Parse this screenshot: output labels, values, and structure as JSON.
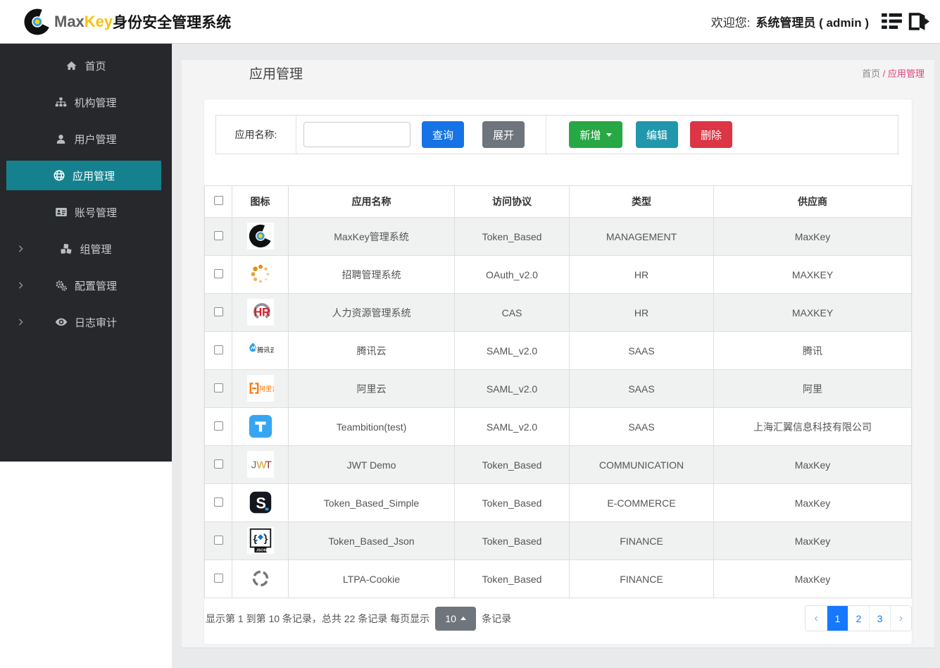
{
  "header": {
    "logo_text_max": "Max",
    "logo_text_key": "Key",
    "logo_text_cn": "身份安全管理系统",
    "welcome_label": "欢迎您:",
    "user_label": "系统管理员 ( admin )"
  },
  "sidebar": {
    "items": [
      {
        "key": "home",
        "icon": "home",
        "label": "首页",
        "active": false,
        "has_children": false
      },
      {
        "key": "org",
        "icon": "sitemap",
        "label": "机构管理",
        "active": false,
        "has_children": false
      },
      {
        "key": "users",
        "icon": "user",
        "label": "用户管理",
        "active": false,
        "has_children": false
      },
      {
        "key": "apps",
        "icon": "globe",
        "label": "应用管理",
        "active": true,
        "has_children": false
      },
      {
        "key": "accounts",
        "icon": "id-card",
        "label": "账号管理",
        "active": false,
        "has_children": false
      },
      {
        "key": "groups",
        "icon": "cubes",
        "label": "组管理",
        "active": false,
        "has_children": true
      },
      {
        "key": "config",
        "icon": "gears",
        "label": "配置管理",
        "active": false,
        "has_children": true
      },
      {
        "key": "audit",
        "icon": "eye",
        "label": "日志审计",
        "active": false,
        "has_children": true
      }
    ]
  },
  "page": {
    "title": "应用管理",
    "breadcrumb": {
      "root": "首页",
      "separator": " / ",
      "current": "应用管理"
    }
  },
  "toolbar": {
    "search_label": "应用名称:",
    "search_value": "",
    "query_label": "查询",
    "expand_label": "展开",
    "add_label": "新增",
    "edit_label": "编辑",
    "delete_label": "删除"
  },
  "table": {
    "headers": [
      "图标",
      "应用名称",
      "访问协议",
      "类型",
      "供应商"
    ],
    "rows": [
      {
        "icon": "maxkey",
        "name": "MaxKey管理系统",
        "protocol": "Token_Based",
        "type": "MANAGEMENT",
        "vendor": "MaxKey"
      },
      {
        "icon": "spinner-dots",
        "name": "招聘管理系统",
        "protocol": "OAuth_v2.0",
        "type": "HR",
        "vendor": "MAXKEY"
      },
      {
        "icon": "hr-logo",
        "name": "人力资源管理系统",
        "protocol": "CAS",
        "type": "HR",
        "vendor": "MAXKEY"
      },
      {
        "icon": "tencent-cloud",
        "name": "腾讯云",
        "protocol": "SAML_v2.0",
        "type": "SAAS",
        "vendor": "腾讯"
      },
      {
        "icon": "aliyun",
        "name": "阿里云",
        "protocol": "SAML_v2.0",
        "type": "SAAS",
        "vendor": "阿里"
      },
      {
        "icon": "teambition",
        "name": "Teambition(test)",
        "protocol": "SAML_v2.0",
        "type": "SAAS",
        "vendor": "上海汇翼信息科技有限公司"
      },
      {
        "icon": "jwt",
        "name": "JWT Demo",
        "protocol": "Token_Based",
        "type": "COMMUNICATION",
        "vendor": "MaxKey"
      },
      {
        "icon": "s-logo",
        "name": "Token_Based_Simple",
        "protocol": "Token_Based",
        "type": "E-COMMERCE",
        "vendor": "MaxKey"
      },
      {
        "icon": "json-logo",
        "name": "Token_Based_Json",
        "protocol": "Token_Based",
        "type": "FINANCE",
        "vendor": "MaxKey"
      },
      {
        "icon": "ltpa",
        "name": "LTPA-Cookie",
        "protocol": "Token_Based",
        "type": "FINANCE",
        "vendor": "MaxKey"
      }
    ]
  },
  "pagination": {
    "summary_prefix": "显示第 1 到第 10 条记录，总共 22 条记录  每页显示",
    "page_size": "10",
    "summary_suffix": "条记录",
    "prev": "‹",
    "next": "›",
    "pages": [
      "1",
      "2",
      "3"
    ],
    "active_page": "1"
  },
  "colors": {
    "primary": "#1673e6",
    "success": "#28a745",
    "info": "#2097ab",
    "danger": "#dc3545",
    "secondary": "#6e757c",
    "sidebar_active": "#15818f",
    "breadcrumb_accent": "#e0407c",
    "pagination_active": "#1677ff"
  }
}
